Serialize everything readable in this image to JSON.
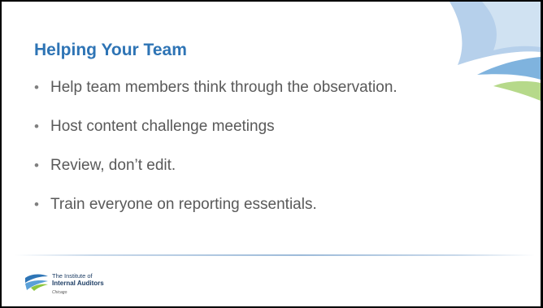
{
  "slide": {
    "title": "Helping Your Team",
    "bullets": [
      "Help team members think through the observation.",
      "Host content challenge meetings",
      "Review, don’t edit.",
      "Train everyone on reporting essentials."
    ],
    "bullet_glyph": "•"
  },
  "footer": {
    "logo": {
      "line1": "The Institute of",
      "line2": "Internal Auditors",
      "line3": "Chicago"
    }
  },
  "colors": {
    "title": "#2e74b5",
    "body_text": "#595959",
    "accent_blue": "#2e75b6",
    "accent_green": "#8dc63f"
  },
  "icons": {
    "corner": "iia-swoosh-decoration",
    "logo": "iia-logo-mark"
  }
}
